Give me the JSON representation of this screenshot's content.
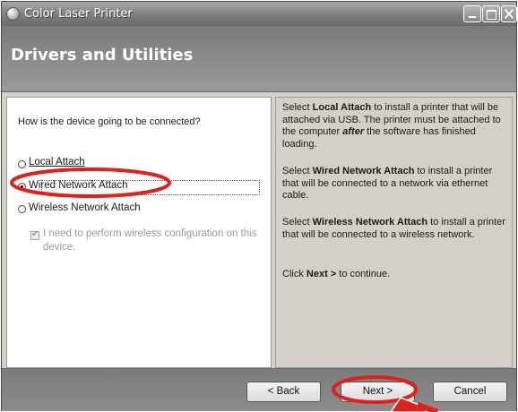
{
  "window": {
    "title": "Color Laser Printer",
    "controls": {
      "minimize_icon": "minimize-icon",
      "maximize_icon": "maximize-icon",
      "close_icon": "close-icon"
    }
  },
  "header": {
    "title": "Drivers and Utilities"
  },
  "left": {
    "question": "How is the device going to be connected?",
    "options": [
      {
        "label": "Local Attach",
        "selected": false
      },
      {
        "label": "Wired Network Attach",
        "selected": true
      },
      {
        "label": "Wireless Network Attach",
        "selected": false
      }
    ],
    "wireless_config": {
      "label": "I need to perform wireless configuration on this device.",
      "checked": true,
      "enabled": false
    }
  },
  "right": {
    "p1": {
      "pre": "Select ",
      "bold": "Local Attach",
      "mid": " to install a printer that will be attached via USB. The printer must be attached to the computer ",
      "emph": "after",
      "post": " the software has finished loading."
    },
    "p2": {
      "pre": "Select ",
      "bold": "Wired Network Attach",
      "post": " to install a printer that will be connected to a network via ethernet cable."
    },
    "p3": {
      "pre": "Select ",
      "bold": "Wireless Network Attach",
      "post": " to install a printer that will be connected to a wireless network."
    },
    "p4": {
      "pre": "Click ",
      "bold": "Next >",
      "post": " to continue."
    }
  },
  "footer": {
    "back_label": "< Back",
    "next_label": "Next >",
    "cancel_label": "Cancel"
  },
  "annotation_colors": {
    "highlight": "#e0201b"
  }
}
